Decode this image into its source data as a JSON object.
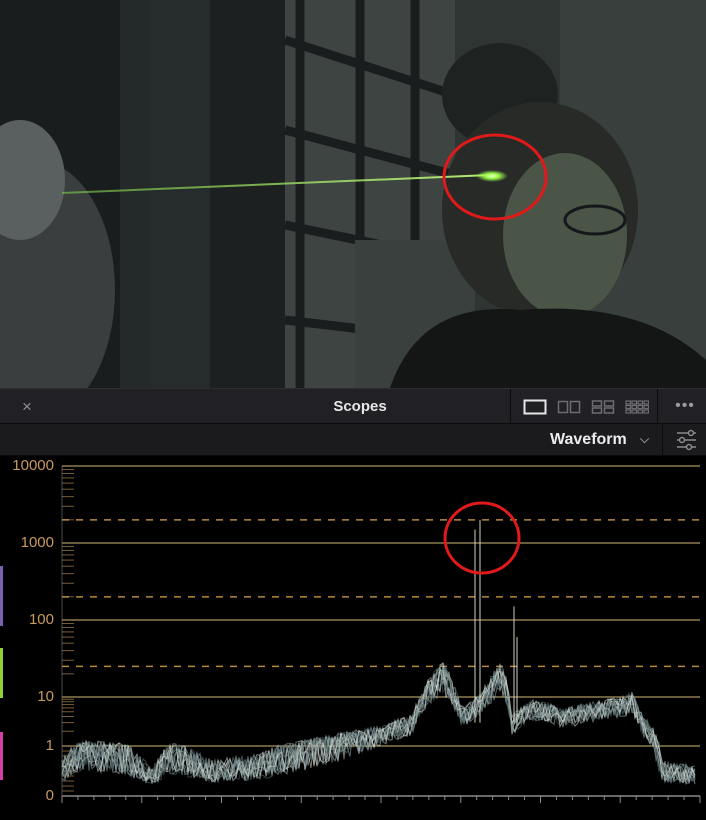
{
  "scopes_panel": {
    "title": "Scopes",
    "close_label": "×",
    "more_label": "•••",
    "mode_label": "Waveform",
    "chevron_label": "⌵"
  },
  "colors": {
    "axis_label": "#c89a5e",
    "solid_grid": "#8c7c52",
    "dashed_grid": "#b8883f",
    "annotation": "#e01a1a",
    "laser": "#a8ff5a"
  },
  "chart_data": {
    "type": "line",
    "scale": "log",
    "ytick_labels": [
      "10000",
      "1000",
      "100",
      "10",
      "1",
      "0"
    ],
    "solid_gridlines": [
      10000,
      1000,
      100,
      10,
      1
    ],
    "dashed_gridlines": [
      2000,
      200,
      25
    ]
  }
}
